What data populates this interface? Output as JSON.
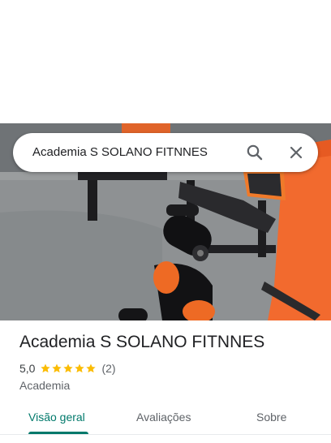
{
  "search": {
    "query": "Academia S SOLANO FITNNES"
  },
  "place": {
    "name": "Academia S SOLANO FITNNES",
    "rating": "5,0",
    "stars": 5,
    "review_count": "(2)",
    "category": "Academia"
  },
  "tabs": [
    {
      "label": "Visão geral",
      "active": true
    },
    {
      "label": "Avaliações",
      "active": false
    },
    {
      "label": "Sobre",
      "active": false
    }
  ],
  "colors": {
    "accent": "#00796b",
    "star": "#fbbc04",
    "wall": "#f26a2e"
  },
  "icons": {
    "search": "search-icon",
    "close": "close-icon",
    "star": "star-icon"
  }
}
